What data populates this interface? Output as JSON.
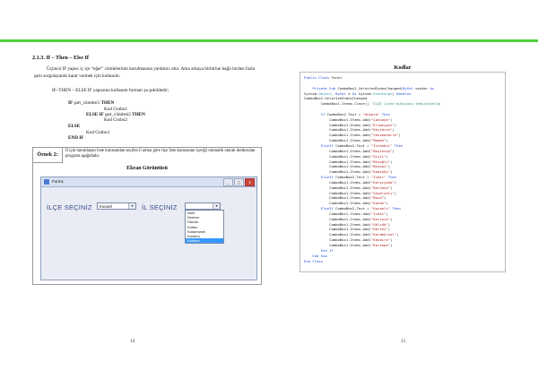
{
  "left_page": {
    "heading": "2.1.3. If – Then – Else If",
    "paragraph": "Üçüncü IF yapısı iç içe “eğer” cümlelerinin kurulmasına yardımcı olur. Arka arkaya birbirine bağlı birden fazla şartı sorgulayarak karar vermek için kullanılır.",
    "format_line": "IF–THEN – ELSE IF yapısının kullanım formatı şu şekildedir;",
    "syntax": {
      "l1_kw": "IF",
      "l1_mid": " şart_cümlesi1 ",
      "l1_kw2": "THEN",
      "l2": "Kod Grubu1",
      "l3_kw": "ELSE IF",
      "l3_mid": " şart_cümlesi2 ",
      "l3_kw2": "THEN",
      "l4": "Kod Grubu2",
      "l5": "ELSE",
      "l6": "Kod Grubu3",
      "l7": "END IF"
    },
    "example_label": "Örnek 2:",
    "example_desc": "İl için tanımlanan liste kutusundan seçilen il adına göre ilçe liste kutusunun içeriği otomatik olarak doldurulan program aşağıdadır.",
    "screen_title": "Ekran Görüntüsü",
    "form_title": "Form1",
    "form_buttons": [
      "_",
      "□",
      "x"
    ],
    "ilce_label": "İLÇE SEÇİNİZ",
    "ilce_value": "Kocaeli",
    "il_label": "İL SEÇİNİZ",
    "il_value": "",
    "dropdown_items": [
      "İzmit",
      "Derince",
      "Gölcük",
      "Körfez",
      "Karamürsel",
      "Kandıra",
      "Kartepe"
    ],
    "dropdown_selected": 6,
    "page_number": "14"
  },
  "right_page": {
    "title": "Kodlar",
    "code_lines": [
      "Public Class Form1",
      "",
      "    Private Sub ComboBox2_SelectedIndexChanged(ByVal sender As",
      "System.Object, ByVal e As System.EventArgs) Handles",
      "ComboBox2.SelectedIndexChanged",
      "        ComboBox1.Items.Clear() 'İLÇE liste kutusunu temizleyelim",
      "",
      "        If ComboBox2.Text = \"Ankara\" Then",
      "            ComboBox1.Items.Add(\"Çankaya\")",
      "            ComboBox1.Items.Add(\"Etimesgut\")",
      "            ComboBox1.Items.Add(\"Keçiören\")",
      "            ComboBox1.Items.Add(\"Yenimahalle\")",
      "            ComboBox1.Items.Add(\"Mamak\")",
      "        ElseIf ComboBox2.Text = \"İstanbul\" Then",
      "            ComboBox1.Items.Add(\"Beşiktaş\")",
      "            ComboBox1.Items.Add(\"Şişli\")",
      "            ComboBox1.Items.Add(\"Beyoğlu\")",
      "            ComboBox1.Items.Add(\"Beykoz\")",
      "            ComboBox1.Items.Add(\"Kadıköy\")",
      "        ElseIf ComboBox2.Text = \"İzmir\" Then",
      "            ComboBox1.Items.Add(\"Karşıyaka\")",
      "            ComboBox1.Items.Add(\"Bornova\")",
      "            ComboBox1.Items.Add(\"Güzelyalı\")",
      "            ComboBox1.Items.Add(\"Buca\")",
      "            ComboBox1.Items.Add(\"Konak\")",
      "        ElseIf ComboBox2.Text = \"Kocaeli\" Then",
      "            ComboBox1.Items.Add(\"İzmit\")",
      "            ComboBox1.Items.Add(\"Derince\")",
      "            ComboBox1.Items.Add(\"Gölcük\")",
      "            ComboBox1.Items.Add(\"Körfez\")",
      "            ComboBox1.Items.Add(\"Karamürsel\")",
      "            ComboBox1.Items.Add(\"Kandıra\")",
      "            ComboBox1.Items.Add(\"Kartepe\")",
      "        End If",
      "    End Sub",
      "End Class"
    ],
    "page_number": "15"
  },
  "colors": {
    "accent_line": "#4cd137",
    "keyword": "#1f4fd8",
    "string": "#b22222",
    "comment": "#2e8b57",
    "type": "#2b91af"
  }
}
